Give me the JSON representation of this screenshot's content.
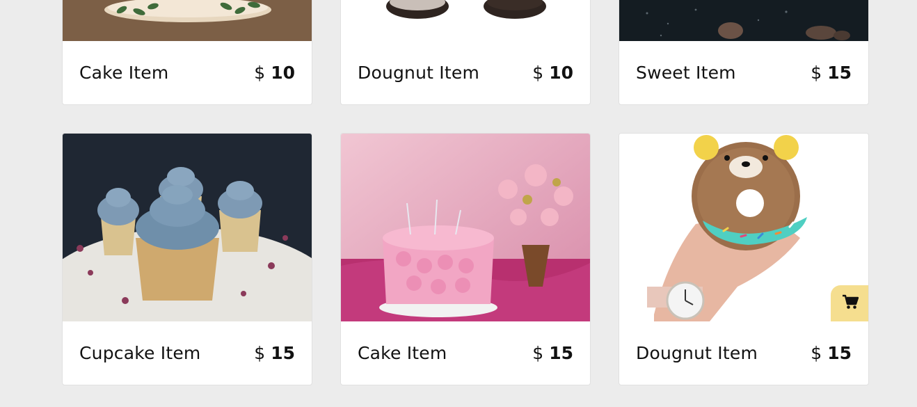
{
  "products": [
    {
      "name": "Cake Item",
      "currency": "$",
      "price": "10",
      "image": "cake-on-wooden-board"
    },
    {
      "name": "Dougnut Item",
      "currency": "$",
      "price": "10",
      "image": "chocolate-doughnuts"
    },
    {
      "name": "Sweet Item",
      "currency": "$",
      "price": "15",
      "image": "chocolate-sweets-dark"
    },
    {
      "name": "Cupcake Item",
      "currency": "$",
      "price": "15",
      "image": "blue-frosted-cupcakes"
    },
    {
      "name": "Cake Item",
      "currency": "$",
      "price": "15",
      "image": "pink-rose-cake-with-flowers"
    },
    {
      "name": "Dougnut Item",
      "currency": "$",
      "price": "15",
      "image": "bear-doughnut-in-hand"
    }
  ],
  "cart_icon": "shopping-cart-icon",
  "colors": {
    "background": "#ececec",
    "card": "#ffffff",
    "cart_button": "#f5de8f"
  }
}
